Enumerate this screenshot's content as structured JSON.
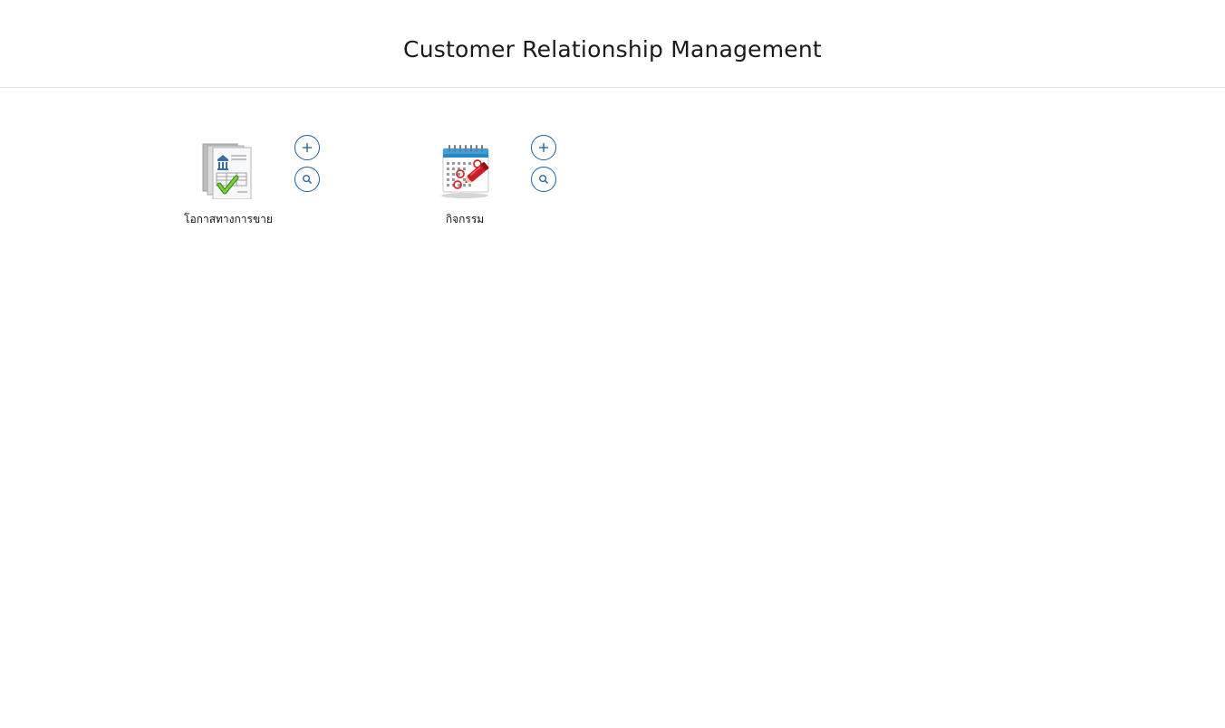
{
  "page": {
    "title": "Customer Relationship Management"
  },
  "tiles": [
    {
      "label": "โอกาสทางการขาย",
      "icon": "sales-opportunity-document-icon",
      "add_icon": "plus-icon",
      "search_icon": "search-icon"
    },
    {
      "label": "กิจกรรม",
      "icon": "calendar-activity-icon",
      "add_icon": "plus-icon",
      "search_icon": "search-icon"
    }
  ],
  "colors": {
    "accent": "#1f5f99",
    "divider": "#e2e2e2"
  }
}
